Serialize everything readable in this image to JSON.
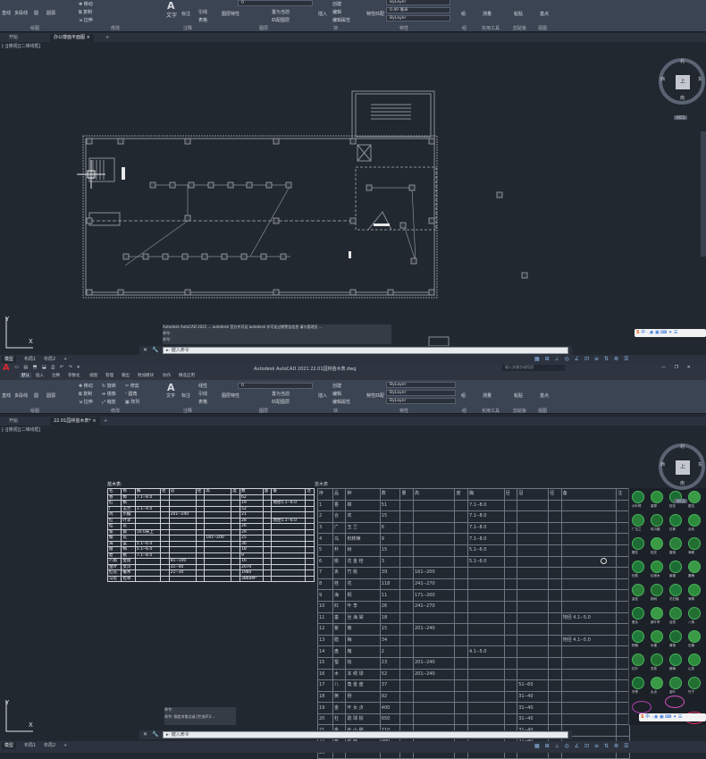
{
  "top_window": {
    "ribbon": {
      "panel_draw": "绘图",
      "panel_modify": "修改",
      "panel_annotation": "注释",
      "panel_layers": "图层",
      "panel_block": "块",
      "panel_properties": "特性",
      "panel_groups": "组",
      "panel_utilities": "实用工具",
      "panel_clipboard": "剪贴板",
      "panel_view": "视图",
      "tool_line": "直线",
      "tool_polyline": "多段线",
      "tool_circle": "圆",
      "tool_arc": "圆弧",
      "tool_move": "移动",
      "tool_copy": "复制",
      "tool_stretch": "拉伸",
      "tool_text": "文字",
      "tool_dimension": "标注",
      "tool_leader": "引线",
      "tool_table": "表格",
      "tool_layer_props": "图层特性",
      "tool_make_current": "置为当前",
      "tool_match_layer": "匹配图层",
      "tool_insert": "插入",
      "tool_create": "创建",
      "tool_edit": "编辑",
      "tool_edit_attr": "编辑属性",
      "tool_match_props": "特性匹配",
      "tool_group": "组",
      "tool_measure": "测量",
      "tool_paste": "粘贴",
      "tool_base": "基点",
      "layer_combo": "0",
      "bylayer_color": "ByLayer",
      "lineweight": "0.40 毫米",
      "bylayer_linetype": "ByLayer"
    },
    "tabs": {
      "start": "开始",
      "doc": "办公楼面平面图"
    },
    "viewport_label": "[-][俯视][二维线框]",
    "viewcube": {
      "face": "上",
      "n": "北",
      "s": "南",
      "w": "西",
      "e": "东",
      "wcs": "WCS"
    },
    "command_history": [
      "Autodesk AutoCAD 2021 ... autodesk 官方许可证 autodesk 许可证过期警告信息 请与管理员 ... ",
      "命令:",
      "命令:"
    ],
    "command_placeholder": "键入命令",
    "ucs_x": "X",
    "ucs_y": "Y"
  },
  "status_bar_top": {
    "model": "模型",
    "layout1": "布局1",
    "layout2": "布局2"
  },
  "bottom_window": {
    "app_title": "Autodesk AutoCAD 2021  22.01园林苗木表.dwg",
    "search_placeholder": "键入关键字或短语",
    "ribbon_tabs": [
      "默认",
      "插入",
      "注释",
      "参数化",
      "视图",
      "管理",
      "输出",
      "附加模块",
      "协作",
      "精选应用"
    ],
    "ribbon": {
      "panel_draw": "绘图",
      "panel_modify": "修改",
      "panel_annotation": "注释",
      "panel_layers": "图层",
      "panel_block": "块",
      "panel_properties": "特性",
      "panel_groups": "组",
      "panel_utilities": "实用工具",
      "panel_clipboard": "剪贴板",
      "panel_view": "视图",
      "tool_line": "直线",
      "tool_polyline": "多段线",
      "tool_circle": "圆",
      "tool_arc": "圆弧",
      "tool_move": "移动",
      "tool_copy": "复制",
      "tool_stretch": "拉伸",
      "tool_rotate": "旋转",
      "tool_mirror": "镜像",
      "tool_scale": "缩放",
      "tool_trim": "修剪",
      "tool_fillet": "圆角",
      "tool_array": "阵列",
      "tool_text": "文字",
      "tool_dimension": "标注",
      "tool_linear": "线性",
      "tool_leader": "引线",
      "tool_table": "表格",
      "tool_layer_props": "图层特性",
      "tool_make_current": "置为当前",
      "tool_match_layer": "匹配图层",
      "tool_insert": "插入",
      "tool_create": "创建",
      "tool_edit": "编辑",
      "tool_edit_attr": "编辑属性",
      "tool_match_props": "特性匹配",
      "tool_group": "组",
      "tool_measure": "测量",
      "tool_paste": "粘贴",
      "tool_base": "基点",
      "layer_combo": "0",
      "bylayer_color": "ByLayer",
      "bylayer_lineweight": "ByLayer",
      "bylayer_linetype": "ByLayer"
    },
    "tabs": {
      "start": "开始",
      "doc": "22.01园林苗木表*"
    },
    "viewport_label": "[-][俯视][二维线框]",
    "viewcube": {
      "face": "上",
      "n": "北",
      "s": "南",
      "w": "西",
      "e": "东",
      "wcs": "WCS"
    },
    "command_history": [
      "命令:",
      "命令: 指定对角点或 [栏选(F)/..."
    ],
    "command_placeholder": "键入命令",
    "ucs_x": "X",
    "ucs_y": "Y"
  },
  "small_table": {
    "title": "苗木表:",
    "header": [
      "名",
      "称",
      "胸",
      "径",
      "冠",
      "径",
      "高",
      "度",
      "数",
      "量",
      "备",
      "注"
    ],
    "rows": [
      [
        "香",
        "樟",
        "7.1--8.0",
        "",
        "",
        "",
        "",
        "",
        "62",
        "",
        "",
        ""
      ],
      [
        "红",
        "枫",
        "",
        "",
        "",
        "",
        "",
        "",
        "19",
        "",
        "地径5.1--6.0",
        ""
      ],
      [
        "广",
        "玉兰",
        "3.1--4.0",
        "",
        "",
        "",
        "",
        "",
        "52",
        "",
        "",
        ""
      ],
      [
        "鸡",
        "爪槭",
        "",
        "",
        "201--240",
        "",
        "",
        "",
        "21",
        "",
        "",
        ""
      ],
      [
        "红",
        "叶李",
        "",
        "",
        "",
        "",
        "",
        "",
        "28",
        "",
        "地径5.1--6.0",
        ""
      ],
      [
        "桂",
        "花",
        "",
        "",
        "",
        "",
        "",
        "",
        "26",
        "",
        "",
        ""
      ],
      [
        "紫",
        "薇",
        "10.0米上",
        "",
        "",
        "",
        "",
        "",
        "29",
        "",
        "",
        ""
      ],
      [
        "樱",
        "花",
        "",
        "",
        "",
        "",
        "181--200",
        "",
        "25",
        "",
        "",
        ""
      ],
      [
        "海",
        "棠",
        "5.1--6.0",
        "",
        "",
        "",
        "",
        "",
        "36",
        "",
        "",
        ""
      ],
      [
        "腊",
        "梅",
        "5.1--6.0",
        "",
        "",
        "",
        "",
        "",
        "18",
        "",
        "",
        ""
      ],
      [
        "碧",
        "桃",
        "7.1--8.0",
        "",
        "",
        "",
        "",
        "",
        "9",
        "",
        "",
        ""
      ],
      [
        "八角",
        "金盘",
        "",
        "",
        "81--100",
        "",
        "",
        "",
        "16",
        "",
        "",
        ""
      ],
      [
        "金叶",
        "女贞",
        "",
        "",
        "31--40",
        "",
        "",
        "",
        "2070",
        "",
        "",
        ""
      ],
      [
        "红花",
        "檵木",
        "",
        "",
        "21--30",
        "",
        "",
        "",
        "1980",
        "",
        "",
        ""
      ],
      [
        "马尼",
        "拉草",
        "",
        "",
        "",
        "",
        "",
        "",
        "3866M²",
        "",
        "",
        ""
      ]
    ]
  },
  "big_table": {
    "title": "苗木表",
    "header": [
      "序",
      "品",
      "种",
      "数",
      "量",
      "高",
      "度",
      "胸",
      "径",
      "冠",
      "径",
      "备",
      "注"
    ],
    "rows": [
      [
        "1",
        "香",
        "樟",
        "51",
        "",
        "",
        "",
        "7.1--8.0",
        "",
        "",
        "",
        "",
        ""
      ],
      [
        "2",
        "合",
        "欢",
        "15",
        "",
        "",
        "",
        "7.1--8.0",
        "",
        "",
        "",
        "",
        ""
      ],
      [
        "3",
        "广",
        "玉 兰",
        "6",
        "",
        "",
        "",
        "7.1--8.0",
        "",
        "",
        "",
        "",
        ""
      ],
      [
        "4",
        "乌",
        "桕柿楝",
        "9",
        "",
        "",
        "",
        "7.1--8.0",
        "",
        "",
        "",
        "",
        ""
      ],
      [
        "5",
        "朴",
        "树",
        "15",
        "",
        "",
        "",
        "5.1--6.0",
        "",
        "",
        "",
        "",
        ""
      ],
      [
        "6",
        "桃",
        "花 金 桂",
        "3",
        "",
        "",
        "",
        "5.1--6.0",
        "",
        "",
        "",
        "",
        ""
      ],
      [
        "7",
        "夹",
        "竹 桃",
        "39",
        "",
        "161--200",
        "",
        "",
        "",
        "",
        "",
        "",
        ""
      ],
      [
        "8",
        "桂",
        "花",
        "118",
        "",
        "241--270",
        "",
        "",
        "",
        "",
        "",
        "",
        ""
      ],
      [
        "9",
        "海",
        "桐",
        "11",
        "",
        "171--200",
        "",
        "",
        "",
        "",
        "",
        "",
        ""
      ],
      [
        "10",
        "红",
        "叶 李",
        "26",
        "",
        "241--270",
        "",
        "",
        "",
        "",
        "",
        "",
        ""
      ],
      [
        "11",
        "垂",
        "丝 海 棠",
        "18",
        "",
        "",
        "",
        "",
        "",
        "",
        "",
        "地径 4.1--5.0",
        ""
      ],
      [
        "12",
        "紫",
        "薇",
        "15",
        "",
        "201--240",
        "",
        "",
        "",
        "",
        "",
        "",
        ""
      ],
      [
        "13",
        "腊",
        "梅",
        "34",
        "",
        "",
        "",
        "",
        "",
        "",
        "",
        "地径 4.1--5.0",
        ""
      ],
      [
        "14",
        "盘",
        "槐",
        "2",
        "",
        "",
        "",
        "4.1--5.0",
        "",
        "",
        "",
        "",
        ""
      ],
      [
        "15",
        "蜀",
        "桧",
        "23",
        "",
        "201--240",
        "",
        "",
        "",
        "",
        "",
        "",
        ""
      ],
      [
        "16",
        "木",
        "本 绣 球",
        "52",
        "",
        "201--240",
        "",
        "",
        "",
        "",
        "",
        "",
        ""
      ],
      [
        "17",
        "八",
        "角 金 盘",
        "37",
        "",
        "",
        "",
        "",
        "",
        "51--60",
        "",
        "",
        ""
      ],
      [
        "18",
        "黄",
        "杨",
        "92",
        "",
        "",
        "",
        "",
        "",
        "31--40",
        "",
        "",
        ""
      ],
      [
        "19",
        "金",
        "叶 女 贞",
        "400",
        "",
        "",
        "",
        "",
        "",
        "31--40",
        "",
        "",
        ""
      ],
      [
        "20",
        "杜",
        "鹃 球 棕",
        "650",
        "",
        "",
        "",
        "",
        "",
        "31--40",
        "",
        "",
        ""
      ],
      [
        "21",
        "金",
        "叶 小 檗",
        "710",
        "",
        "",
        "",
        "",
        "",
        "31--40",
        "",
        "",
        ""
      ],
      [
        "22",
        "紫",
        "叶 桂",
        "980",
        "",
        "",
        "",
        "",
        "",
        "31--40",
        "",
        "",
        ""
      ],
      [
        "23",
        "",
        "",
        "",
        "",
        "",
        "",
        "",
        "",
        "",
        "",
        "",
        ""
      ]
    ]
  },
  "palette_labels": [
    "大叶樟",
    "香樟",
    "桂花",
    "银杏",
    "广玉兰",
    "鸡爪槭",
    "红枫",
    "合欢",
    "樱花",
    "桂花",
    "碧桃",
    "海棠",
    "杜鹃",
    "红继木",
    "紫薇",
    "腊梅",
    "金桂",
    "柳树",
    "花石榴",
    "海桐",
    "垂丝",
    "紫叶李",
    "含笑",
    "八角",
    "棕榈",
    "木槿",
    "黄杨",
    "石楠",
    "红叶",
    "苏铁",
    "蜡梅",
    "山茶",
    "冬青",
    "女贞",
    "金叶",
    "竹子"
  ],
  "ime_toolbar": {
    "label": "中"
  },
  "status_bar_bottom": {
    "model": "模型",
    "layout1": "布局1",
    "layout2": "布局2"
  }
}
